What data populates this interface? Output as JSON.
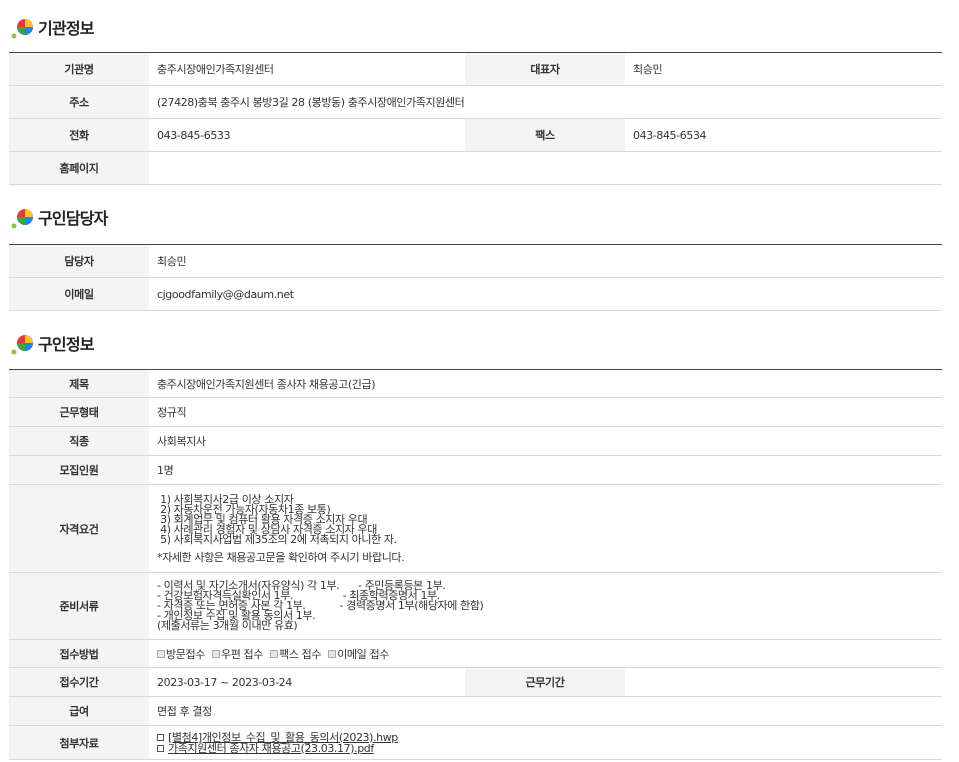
{
  "org": {
    "title": "기관정보",
    "name_label": "기관명",
    "name": "충주시장애인가족지원센터",
    "rep_label": "대표자",
    "rep": "최승민",
    "addr_label": "주소",
    "addr": "(27428)충북 충주시 봉방3길 28 (봉방동) 충주시장애인가족지원센터",
    "tel_label": "전화",
    "tel": "043-845-6533",
    "fax_label": "팩스",
    "fax": "043-845-6534",
    "home_label": "홈페이지",
    "home": ""
  },
  "contact": {
    "title": "구인담당자",
    "person_label": "담당자",
    "person": "최승민",
    "email_label": "이메일",
    "email": "cjgoodfamily@@daum.net"
  },
  "job": {
    "title": "구인정보",
    "subject_label": "제목",
    "subject": "충주시장애인가족지원센터 종사자 채용공고(긴급)",
    "type_label": "근무형태",
    "type": "정규직",
    "kind_label": "직종",
    "kind": "사회복지사",
    "count_label": "모집인원",
    "count": "1명",
    "req_label": "자격요건",
    "req_lines": [
      " 1) 사회복지사2급 이상 소지자",
      " 2) 자동차운전 가능자(자동차1종 보통)",
      " 3) 회계업무 및 컴퓨터 활용 자격증 소지자 우대",
      " 4) 사례관리 경험자 및 상담사 자격증 소지자 우대",
      " 5) 사회복지사업법 제35조의 2에 저촉되지 아니한 자."
    ],
    "req_note": "*자세한 사항은 채용공고문을 확인하여 주시기 바랍니다.",
    "docs_label": "준비서류",
    "docs_lines": [
      "- 이력서 및 자기소개서(자유양식) 각 1부.      - 주민등록등본 1부.",
      "- 건강보험자격득실확인서 1부.                - 최종학력증명서 1부.",
      "- 자격증 또는 면허증 사본 각 1부.           - 경력증명서 1부(해당자에 한함)",
      "- 개인정보 수집 및 활용 동의서 1부.",
      "(제출서류는 3개월 이내만 유효)"
    ],
    "method_label": "접수방법",
    "methods": [
      "방문접수",
      "우편 접수",
      "팩스 접수",
      "이메일 접수"
    ],
    "period_label": "접수기간",
    "period": "2023-03-17 ~ 2023-03-24",
    "workperiod_label": "근무기간",
    "workperiod": "",
    "pay_label": "급여",
    "pay": "면접 후 결정",
    "attach_label": "첨부자료",
    "attachments": [
      "[별첨4]개인정보_수집_및_활용_동의서(2023).hwp",
      "가족지원센터 종사자 채용공고(23.03.17).pdf"
    ]
  }
}
